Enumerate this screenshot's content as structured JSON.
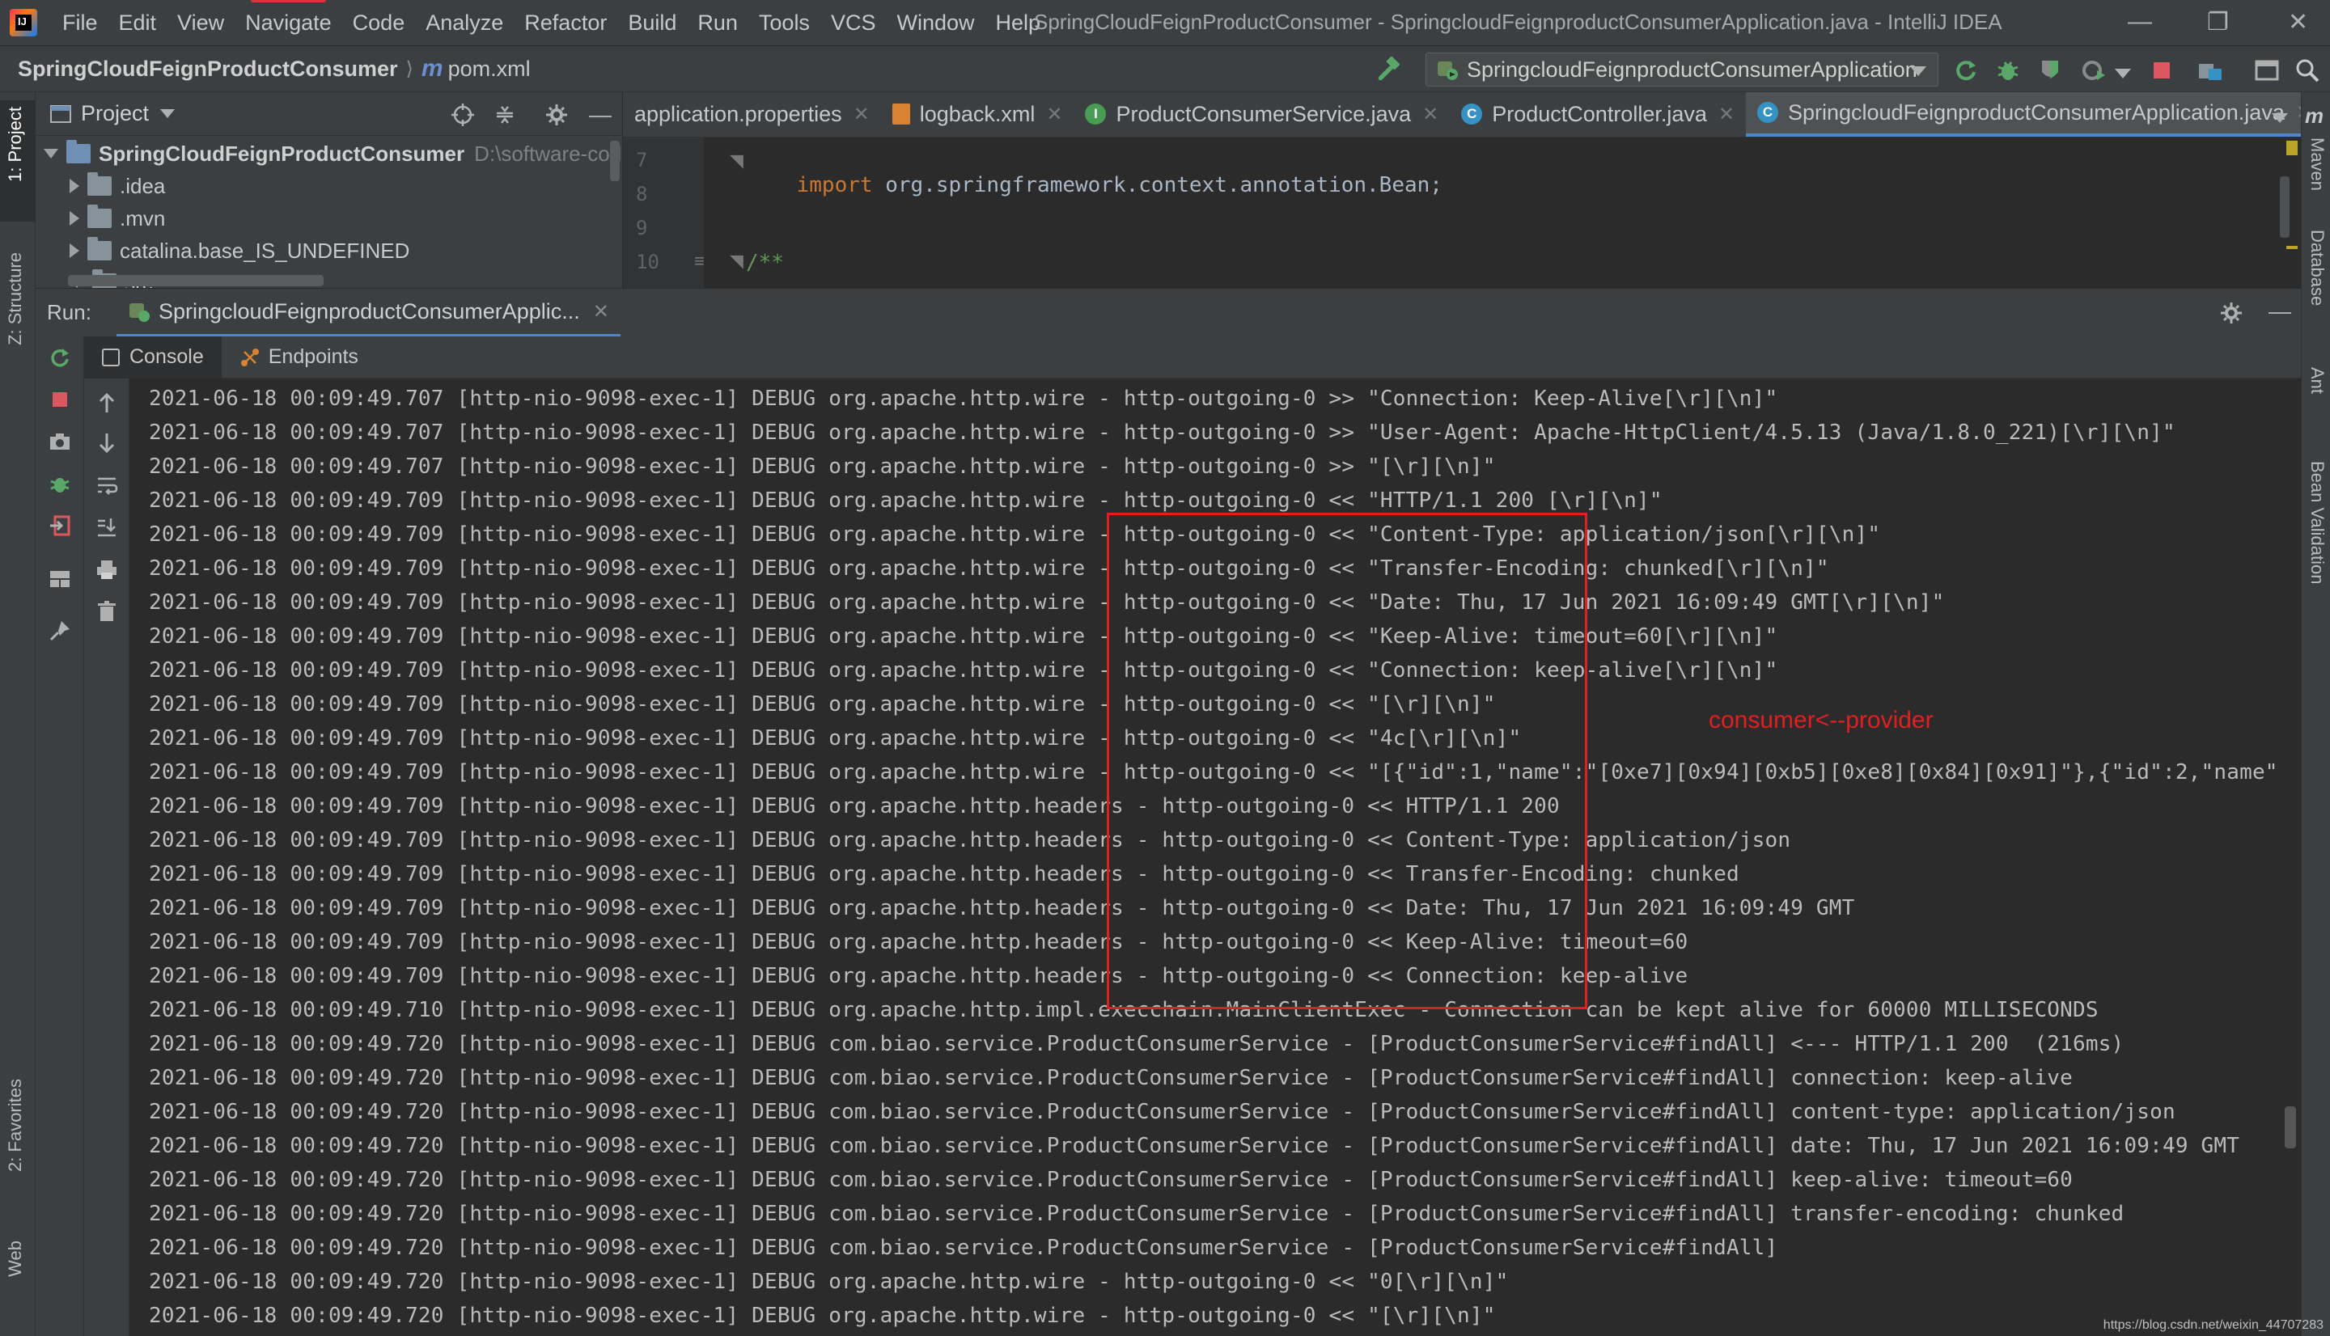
{
  "menubar": {
    "items": [
      "File",
      "Edit",
      "View",
      "Navigate",
      "Code",
      "Analyze",
      "Refactor",
      "Build",
      "Run",
      "Tools",
      "VCS",
      "Window",
      "Help"
    ],
    "window_title": "SpringCloudFeignProductConsumer - SpringcloudFeignproductConsumerApplication.java - IntelliJ IDEA"
  },
  "navbar": {
    "project": "SpringCloudFeignProductConsumer",
    "file": "pom.xml",
    "run_config": "SpringcloudFeignproductConsumerApplication"
  },
  "left_tabs": {
    "project": "1: Project",
    "structure": "Z: Structure",
    "favorites": "2: Favorites",
    "web": "Web"
  },
  "right_tabs": {
    "maven": "Maven",
    "database": "Database",
    "ant": "Ant",
    "bean_validation": "Bean Validation"
  },
  "project_panel": {
    "title": "Project",
    "root": "SpringCloudFeignProductConsumer",
    "root_path": "D:\\software-code",
    "items": [
      ".idea",
      ".mvn",
      "catalina.base_IS_UNDEFINED",
      "src"
    ]
  },
  "editor": {
    "tabs": [
      "application.properties",
      "logback.xml",
      "ProductConsumerService.java",
      "ProductController.java",
      "SpringcloudFeignproductConsumerApplication.java"
    ],
    "line_numbers": [
      "7",
      "8",
      "9",
      "10"
    ],
    "import_kw": "import",
    "import_pkg": "org.springframework.context.annotation.Bean;",
    "comment": "/**"
  },
  "run_panel": {
    "label": "Run:",
    "tab": "SpringcloudFeignproductConsumerApplic...",
    "console_tab": "Console",
    "endpoints_tab": "Endpoints"
  },
  "console": {
    "lines": [
      "2021-06-18 00:09:49.707 [http-nio-9098-exec-1] DEBUG org.apache.http.wire - http-outgoing-0 >> \"Connection: Keep-Alive[\\r][\\n]\"",
      "2021-06-18 00:09:49.707 [http-nio-9098-exec-1] DEBUG org.apache.http.wire - http-outgoing-0 >> \"User-Agent: Apache-HttpClient/4.5.13 (Java/1.8.0_221)[\\r][\\n]\"",
      "2021-06-18 00:09:49.707 [http-nio-9098-exec-1] DEBUG org.apache.http.wire - http-outgoing-0 >> \"[\\r][\\n]\"",
      "2021-06-18 00:09:49.709 [http-nio-9098-exec-1] DEBUG org.apache.http.wire - http-outgoing-0 << \"HTTP/1.1 200 [\\r][\\n]\"",
      "2021-06-18 00:09:49.709 [http-nio-9098-exec-1] DEBUG org.apache.http.wire - http-outgoing-0 << \"Content-Type: application/json[\\r][\\n]\"",
      "2021-06-18 00:09:49.709 [http-nio-9098-exec-1] DEBUG org.apache.http.wire - http-outgoing-0 << \"Transfer-Encoding: chunked[\\r][\\n]\"",
      "2021-06-18 00:09:49.709 [http-nio-9098-exec-1] DEBUG org.apache.http.wire - http-outgoing-0 << \"Date: Thu, 17 Jun 2021 16:09:49 GMT[\\r][\\n]\"",
      "2021-06-18 00:09:49.709 [http-nio-9098-exec-1] DEBUG org.apache.http.wire - http-outgoing-0 << \"Keep-Alive: timeout=60[\\r][\\n]\"",
      "2021-06-18 00:09:49.709 [http-nio-9098-exec-1] DEBUG org.apache.http.wire - http-outgoing-0 << \"Connection: keep-alive[\\r][\\n]\"",
      "2021-06-18 00:09:49.709 [http-nio-9098-exec-1] DEBUG org.apache.http.wire - http-outgoing-0 << \"[\\r][\\n]\"",
      "2021-06-18 00:09:49.709 [http-nio-9098-exec-1] DEBUG org.apache.http.wire - http-outgoing-0 << \"4c[\\r][\\n]\"",
      "2021-06-18 00:09:49.709 [http-nio-9098-exec-1] DEBUG org.apache.http.wire - http-outgoing-0 << \"[{\"id\":1,\"name\":\"[0xe7][0x94][0xb5][0xe8][0x84][0x91]\"},{\"id\":2,\"name\"",
      "2021-06-18 00:09:49.709 [http-nio-9098-exec-1] DEBUG org.apache.http.headers - http-outgoing-0 << HTTP/1.1 200",
      "2021-06-18 00:09:49.709 [http-nio-9098-exec-1] DEBUG org.apache.http.headers - http-outgoing-0 << Content-Type: application/json",
      "2021-06-18 00:09:49.709 [http-nio-9098-exec-1] DEBUG org.apache.http.headers - http-outgoing-0 << Transfer-Encoding: chunked",
      "2021-06-18 00:09:49.709 [http-nio-9098-exec-1] DEBUG org.apache.http.headers - http-outgoing-0 << Date: Thu, 17 Jun 2021 16:09:49 GMT",
      "2021-06-18 00:09:49.709 [http-nio-9098-exec-1] DEBUG org.apache.http.headers - http-outgoing-0 << Keep-Alive: timeout=60",
      "2021-06-18 00:09:49.709 [http-nio-9098-exec-1] DEBUG org.apache.http.headers - http-outgoing-0 << Connection: keep-alive",
      "2021-06-18 00:09:49.710 [http-nio-9098-exec-1] DEBUG org.apache.http.impl.execchain.MainClientExec - Connection can be kept alive for 60000 MILLISECONDS",
      "2021-06-18 00:09:49.720 [http-nio-9098-exec-1] DEBUG com.biao.service.ProductConsumerService - [ProductConsumerService#findAll] <--- HTTP/1.1 200  (216ms)",
      "2021-06-18 00:09:49.720 [http-nio-9098-exec-1] DEBUG com.biao.service.ProductConsumerService - [ProductConsumerService#findAll] connection: keep-alive",
      "2021-06-18 00:09:49.720 [http-nio-9098-exec-1] DEBUG com.biao.service.ProductConsumerService - [ProductConsumerService#findAll] content-type: application/json",
      "2021-06-18 00:09:49.720 [http-nio-9098-exec-1] DEBUG com.biao.service.ProductConsumerService - [ProductConsumerService#findAll] date: Thu, 17 Jun 2021 16:09:49 GMT",
      "2021-06-18 00:09:49.720 [http-nio-9098-exec-1] DEBUG com.biao.service.ProductConsumerService - [ProductConsumerService#findAll] keep-alive: timeout=60",
      "2021-06-18 00:09:49.720 [http-nio-9098-exec-1] DEBUG com.biao.service.ProductConsumerService - [ProductConsumerService#findAll] transfer-encoding: chunked",
      "2021-06-18 00:09:49.720 [http-nio-9098-exec-1] DEBUG com.biao.service.ProductConsumerService - [ProductConsumerService#findAll]",
      "2021-06-18 00:09:49.720 [http-nio-9098-exec-1] DEBUG org.apache.http.wire - http-outgoing-0 << \"0[\\r][\\n]\"",
      "2021-06-18 00:09:49.720 [http-nio-9098-exec-1] DEBUG org.apache.http.wire - http-outgoing-0 << \"[\\r][\\n]\""
    ]
  },
  "annotation": "consumer<--provider",
  "watermark": "https://blog.csdn.net/weixin_44707283",
  "colors": {
    "highlight": "#e02020",
    "accent": "#4a88c7",
    "background": "#2b2b2b"
  }
}
